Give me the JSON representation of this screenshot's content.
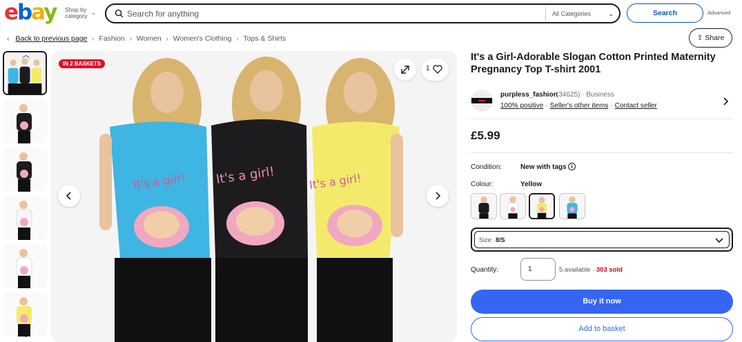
{
  "header": {
    "logo": {
      "e": "e",
      "b": "b",
      "a": "a",
      "y": "y"
    },
    "shop_by_category": "Shop by category",
    "search_placeholder": "Search for anything",
    "category_select": "All Categories",
    "search_button": "Search",
    "advanced_link": "Advanced"
  },
  "breadcrumb": {
    "back": "Back to previous page",
    "items": [
      "Fashion",
      "Women",
      "Women's Clothing",
      "Tops & Shirts"
    ]
  },
  "share_button": "Share",
  "gallery": {
    "badge": "IN 2 BASKETS",
    "watch_count": "1",
    "thumbnail_count": 6
  },
  "product": {
    "title": "It's a Girl-Adorable Slogan Cotton Printed Maternity Pregnancy Top T-shirt 2001",
    "seller": {
      "name": "purpless_fashion",
      "feedback": "(34625)",
      "type": "Business",
      "positive": "100% positive",
      "other_items": "Seller's other items",
      "contact": "Contact seller"
    },
    "price": "£5.99",
    "condition_label": "Condition:",
    "condition_value": "New with tags",
    "colour_label": "Colour:",
    "colour_value": "Yellow",
    "size_label": "Size:",
    "size_value": "8/S",
    "quantity_label": "Quantity:",
    "quantity_value": "1",
    "available": "5 available",
    "sold": "303 sold",
    "buy_now": "Buy it now",
    "add_to_basket": "Add to basket"
  },
  "colors": {
    "accent": "#3665f3",
    "badge": "#e0102a",
    "sold": "#c0071d",
    "blue_shirt": "#3fb5e3",
    "black_shirt": "#1c1c1e",
    "yellow_shirt": "#f3ea6c"
  }
}
